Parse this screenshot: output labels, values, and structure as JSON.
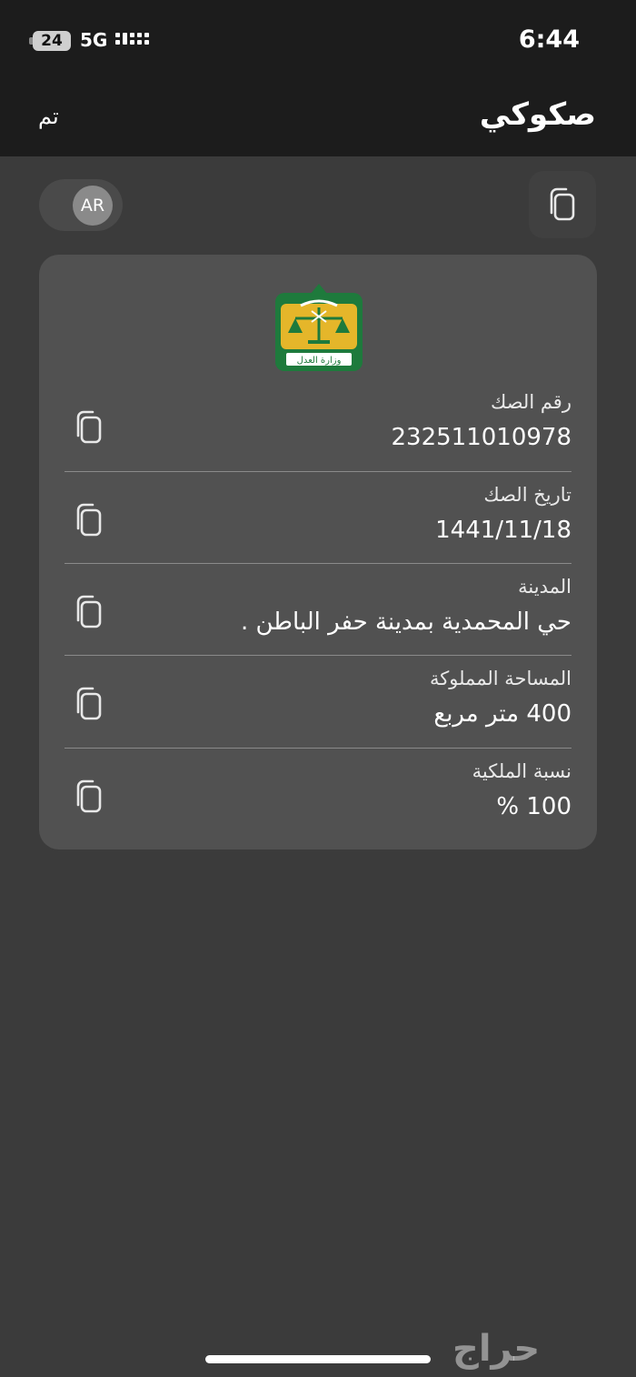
{
  "status_bar": {
    "battery": "24",
    "network": "5G",
    "time": "6:44"
  },
  "nav": {
    "done_label": "تم",
    "title": "صكوكي"
  },
  "lang_toggle": {
    "label": "AR"
  },
  "fields": [
    {
      "label": "رقم الصك",
      "value": "232511010978"
    },
    {
      "label": "تاريخ الصك",
      "value": "1441/11/18"
    },
    {
      "label": "المدينة",
      "value": "حي  المحمدية  بمدينة حفر الباطن ."
    },
    {
      "label": "المساحة المملوكة",
      "value": "400 متر مربع"
    },
    {
      "label": "نسبة الملكية",
      "value": "100 %"
    }
  ],
  "logo_text": "وزارة العدل",
  "watermark": "حراج",
  "colors": {
    "background": "#3b3b3b",
    "header": "#1c1c1c",
    "card": "#515151",
    "logo_green": "#1e7a3c",
    "logo_gold": "#e5b62a"
  }
}
